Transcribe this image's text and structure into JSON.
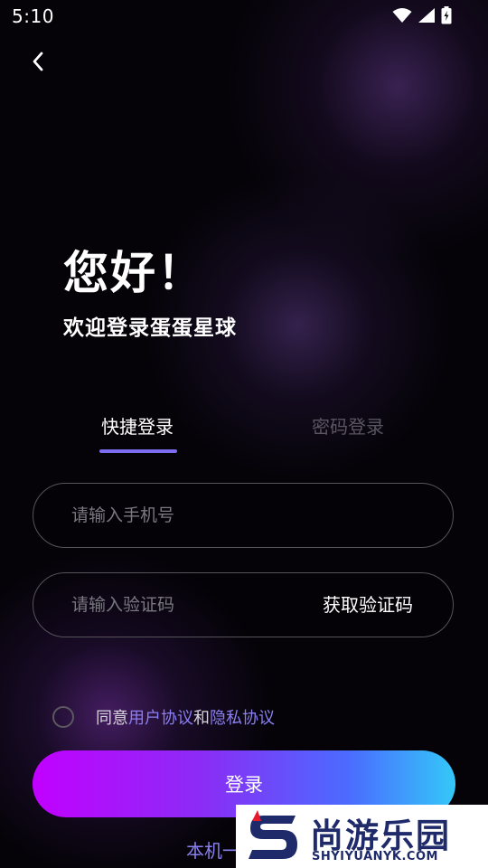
{
  "status_bar": {
    "time": "5:10",
    "icons": [
      "wifi-icon",
      "signal-icon",
      "battery-charging-icon"
    ]
  },
  "nav": {
    "back_icon": "chevron-left-icon"
  },
  "header": {
    "greeting": "您好！",
    "welcome": "欢迎登录蛋蛋星球"
  },
  "tabs": [
    {
      "label": "快捷登录",
      "active": true
    },
    {
      "label": "密码登录",
      "active": false
    }
  ],
  "form": {
    "phone": {
      "value": "",
      "placeholder": "请输入手机号"
    },
    "code": {
      "value": "",
      "placeholder": "请输入验证码",
      "get_code_label": "获取验证码"
    }
  },
  "agreement": {
    "checked": false,
    "prefix": "同意",
    "user_agreement": "用户协议",
    "conjunction": "和",
    "privacy_agreement": "隐私协议"
  },
  "login_button": {
    "label": "登录"
  },
  "one_click_login": {
    "label": "本机一"
  },
  "watermark": {
    "title": "尚游乐园",
    "url": "SHYIYUANYK.COM"
  },
  "colors": {
    "accent": "#7b6cf0",
    "link": "#8a7ff0",
    "gradient_start": "#c200ff",
    "gradient_end": "#34c8f8"
  }
}
